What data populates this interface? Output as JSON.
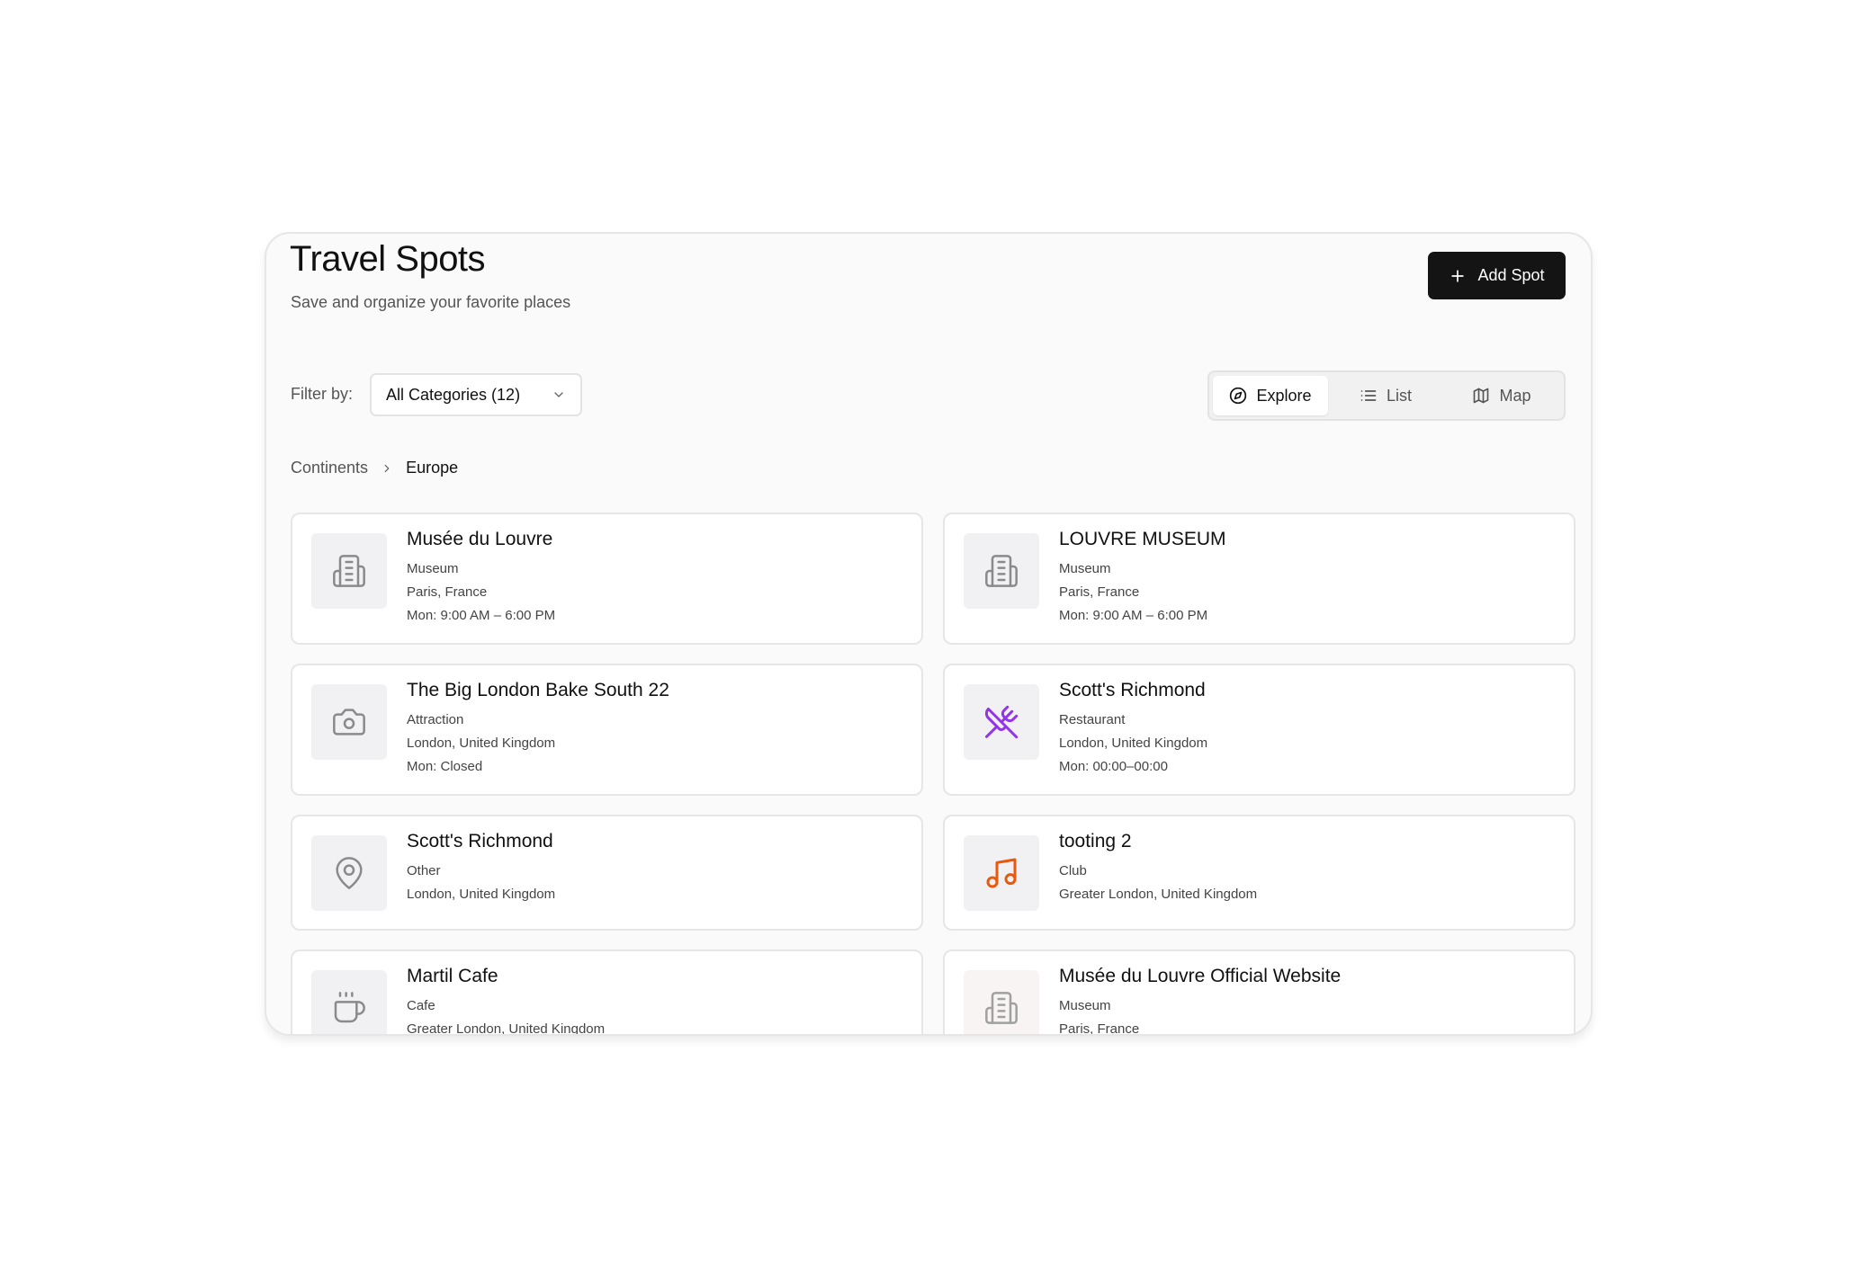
{
  "header": {
    "title": "Travel Spots",
    "subtitle": "Save and organize your favorite places",
    "add_label": "Add Spot"
  },
  "filter": {
    "label": "Filter by:",
    "selected": "All Categories (12)"
  },
  "views": [
    {
      "label": "Explore",
      "icon": "compass-icon",
      "active": true
    },
    {
      "label": "List",
      "icon": "list-icon",
      "active": false
    },
    {
      "label": "Map",
      "icon": "map-icon",
      "active": false
    }
  ],
  "breadcrumb": {
    "items": [
      "Continents",
      "Europe"
    ]
  },
  "colors": {
    "restaurant_icon": "#9333ea",
    "club_icon": "#ea580c",
    "neutral_icon": "#8a8a8a",
    "primary_button": "#141414"
  },
  "spots": [
    {
      "name": "Musée du Louvre",
      "category": "Museum",
      "location": "Paris, France",
      "hours": "Mon: 9:00 AM – 6:00 PM",
      "icon": "building-icon"
    },
    {
      "name": "LOUVRE MUSEUM",
      "category": "Museum",
      "location": "Paris, France",
      "hours": "Mon: 9:00 AM – 6:00 PM",
      "icon": "building-icon"
    },
    {
      "name": "The Big London Bake South 22",
      "category": "Attraction",
      "location": "London, United Kingdom",
      "hours": "Mon: Closed",
      "icon": "camera-icon"
    },
    {
      "name": "Scott's Richmond",
      "category": "Restaurant",
      "location": "London, United Kingdom",
      "hours": "Mon: 00:00–00:00",
      "icon": "utensils-crossed-icon"
    },
    {
      "name": "Scott's Richmond",
      "category": "Other",
      "location": "London, United Kingdom",
      "icon": "map-pin-icon"
    },
    {
      "name": "tooting 2",
      "category": "Club",
      "location": "Greater London, United Kingdom",
      "icon": "music-icon"
    },
    {
      "name": "Martil Cafe",
      "category": "Cafe",
      "location": "Greater London, United Kingdom",
      "icon": "coffee-icon"
    },
    {
      "name": "Musée du Louvre Official Website",
      "category": "Museum",
      "location": "Paris, France",
      "icon": "building-icon"
    }
  ]
}
